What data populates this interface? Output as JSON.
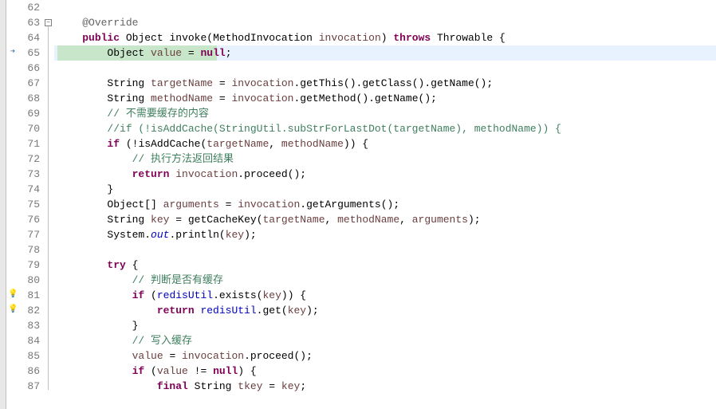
{
  "line_start": 62,
  "lines": [
    {
      "num": 62,
      "marker": null,
      "fold": null,
      "tokens": []
    },
    {
      "num": 63,
      "marker": null,
      "fold": "minus",
      "tokens": [
        {
          "t": "    ",
          "c": ""
        },
        {
          "t": "@Override",
          "c": "anno"
        }
      ]
    },
    {
      "num": 64,
      "marker": null,
      "fold": null,
      "tokens": [
        {
          "t": "    ",
          "c": ""
        },
        {
          "t": "public",
          "c": "kw"
        },
        {
          "t": " ",
          "c": ""
        },
        {
          "t": "Object",
          "c": "type"
        },
        {
          "t": " ",
          "c": ""
        },
        {
          "t": "invoke",
          "c": "method"
        },
        {
          "t": "(",
          "c": "punct"
        },
        {
          "t": "MethodInvocation",
          "c": "type"
        },
        {
          "t": " ",
          "c": ""
        },
        {
          "t": "invocation",
          "c": "param"
        },
        {
          "t": ") ",
          "c": "punct"
        },
        {
          "t": "throws",
          "c": "kw"
        },
        {
          "t": " ",
          "c": ""
        },
        {
          "t": "Throwable",
          "c": "type"
        },
        {
          "t": " {",
          "c": "punct"
        }
      ]
    },
    {
      "num": 65,
      "marker": "arrow",
      "fold": null,
      "highlight": "full",
      "partial_highlight_width": 200,
      "tokens": [
        {
          "t": "        ",
          "c": ""
        },
        {
          "t": "Object",
          "c": "type"
        },
        {
          "t": " ",
          "c": ""
        },
        {
          "t": "value",
          "c": "local"
        },
        {
          "t": " = ",
          "c": "punct"
        },
        {
          "t": "null",
          "c": "kw"
        },
        {
          "t": ";",
          "c": "punct"
        }
      ]
    },
    {
      "num": 66,
      "marker": null,
      "fold": null,
      "tokens": []
    },
    {
      "num": 67,
      "marker": null,
      "fold": null,
      "tokens": [
        {
          "t": "        ",
          "c": ""
        },
        {
          "t": "String",
          "c": "type"
        },
        {
          "t": " ",
          "c": ""
        },
        {
          "t": "targetName",
          "c": "local"
        },
        {
          "t": " = ",
          "c": "punct"
        },
        {
          "t": "invocation",
          "c": "param"
        },
        {
          "t": ".",
          "c": "punct"
        },
        {
          "t": "getThis",
          "c": "method"
        },
        {
          "t": "().",
          "c": "punct"
        },
        {
          "t": "getClass",
          "c": "method"
        },
        {
          "t": "().",
          "c": "punct"
        },
        {
          "t": "getName",
          "c": "method"
        },
        {
          "t": "();",
          "c": "punct"
        }
      ]
    },
    {
      "num": 68,
      "marker": null,
      "fold": null,
      "tokens": [
        {
          "t": "        ",
          "c": ""
        },
        {
          "t": "String",
          "c": "type"
        },
        {
          "t": " ",
          "c": ""
        },
        {
          "t": "methodName",
          "c": "local"
        },
        {
          "t": " = ",
          "c": "punct"
        },
        {
          "t": "invocation",
          "c": "param"
        },
        {
          "t": ".",
          "c": "punct"
        },
        {
          "t": "getMethod",
          "c": "method"
        },
        {
          "t": "().",
          "c": "punct"
        },
        {
          "t": "getName",
          "c": "method"
        },
        {
          "t": "();",
          "c": "punct"
        }
      ]
    },
    {
      "num": 69,
      "marker": null,
      "fold": null,
      "tokens": [
        {
          "t": "        ",
          "c": ""
        },
        {
          "t": "// 不需要缓存的内容",
          "c": "comment"
        }
      ]
    },
    {
      "num": 70,
      "marker": null,
      "fold": null,
      "tokens": [
        {
          "t": "        ",
          "c": ""
        },
        {
          "t": "//if (!isAddCache(StringUtil.subStrForLastDot(targetName), methodName)) {",
          "c": "comment"
        }
      ]
    },
    {
      "num": 71,
      "marker": null,
      "fold": null,
      "tokens": [
        {
          "t": "        ",
          "c": ""
        },
        {
          "t": "if",
          "c": "kw"
        },
        {
          "t": " (!",
          "c": "punct"
        },
        {
          "t": "isAddCache",
          "c": "method"
        },
        {
          "t": "(",
          "c": "punct"
        },
        {
          "t": "targetName",
          "c": "local"
        },
        {
          "t": ", ",
          "c": "punct"
        },
        {
          "t": "methodName",
          "c": "local"
        },
        {
          "t": ")) {",
          "c": "punct"
        }
      ]
    },
    {
      "num": 72,
      "marker": null,
      "fold": null,
      "tokens": [
        {
          "t": "            ",
          "c": ""
        },
        {
          "t": "// 执行方法返回结果",
          "c": "comment"
        }
      ]
    },
    {
      "num": 73,
      "marker": null,
      "fold": null,
      "tokens": [
        {
          "t": "            ",
          "c": ""
        },
        {
          "t": "return",
          "c": "kw"
        },
        {
          "t": " ",
          "c": ""
        },
        {
          "t": "invocation",
          "c": "param"
        },
        {
          "t": ".",
          "c": "punct"
        },
        {
          "t": "proceed",
          "c": "method"
        },
        {
          "t": "();",
          "c": "punct"
        }
      ]
    },
    {
      "num": 74,
      "marker": null,
      "fold": null,
      "tokens": [
        {
          "t": "        }",
          "c": "punct"
        }
      ]
    },
    {
      "num": 75,
      "marker": null,
      "fold": null,
      "tokens": [
        {
          "t": "        ",
          "c": ""
        },
        {
          "t": "Object",
          "c": "type"
        },
        {
          "t": "[] ",
          "c": "punct"
        },
        {
          "t": "arguments",
          "c": "local"
        },
        {
          "t": " = ",
          "c": "punct"
        },
        {
          "t": "invocation",
          "c": "param"
        },
        {
          "t": ".",
          "c": "punct"
        },
        {
          "t": "getArguments",
          "c": "method"
        },
        {
          "t": "();",
          "c": "punct"
        }
      ]
    },
    {
      "num": 76,
      "marker": null,
      "fold": null,
      "tokens": [
        {
          "t": "        ",
          "c": ""
        },
        {
          "t": "String",
          "c": "type"
        },
        {
          "t": " ",
          "c": ""
        },
        {
          "t": "key",
          "c": "local"
        },
        {
          "t": " = ",
          "c": "punct"
        },
        {
          "t": "getCacheKey",
          "c": "method"
        },
        {
          "t": "(",
          "c": "punct"
        },
        {
          "t": "targetName",
          "c": "local"
        },
        {
          "t": ", ",
          "c": "punct"
        },
        {
          "t": "methodName",
          "c": "local"
        },
        {
          "t": ", ",
          "c": "punct"
        },
        {
          "t": "arguments",
          "c": "local"
        },
        {
          "t": ");",
          "c": "punct"
        }
      ]
    },
    {
      "num": 77,
      "marker": null,
      "fold": null,
      "tokens": [
        {
          "t": "        ",
          "c": ""
        },
        {
          "t": "System",
          "c": "type"
        },
        {
          "t": ".",
          "c": "punct"
        },
        {
          "t": "out",
          "c": "static-field"
        },
        {
          "t": ".",
          "c": "punct"
        },
        {
          "t": "println",
          "c": "method"
        },
        {
          "t": "(",
          "c": "punct"
        },
        {
          "t": "key",
          "c": "local"
        },
        {
          "t": ");",
          "c": "punct"
        }
      ]
    },
    {
      "num": 78,
      "marker": null,
      "fold": null,
      "tokens": []
    },
    {
      "num": 79,
      "marker": null,
      "fold": null,
      "tokens": [
        {
          "t": "        ",
          "c": ""
        },
        {
          "t": "try",
          "c": "kw"
        },
        {
          "t": " {",
          "c": "punct"
        }
      ]
    },
    {
      "num": 80,
      "marker": null,
      "fold": null,
      "tokens": [
        {
          "t": "            ",
          "c": ""
        },
        {
          "t": "// 判断是否有缓存",
          "c": "comment"
        }
      ]
    },
    {
      "num": 81,
      "marker": "light",
      "fold": null,
      "tokens": [
        {
          "t": "            ",
          "c": ""
        },
        {
          "t": "if",
          "c": "kw"
        },
        {
          "t": " (",
          "c": "punct"
        },
        {
          "t": "redisUtil",
          "c": "field"
        },
        {
          "t": ".",
          "c": "punct"
        },
        {
          "t": "exists",
          "c": "method"
        },
        {
          "t": "(",
          "c": "punct"
        },
        {
          "t": "key",
          "c": "local"
        },
        {
          "t": ")) {",
          "c": "punct"
        }
      ]
    },
    {
      "num": 82,
      "marker": "light",
      "fold": null,
      "tokens": [
        {
          "t": "                ",
          "c": ""
        },
        {
          "t": "return",
          "c": "kw"
        },
        {
          "t": " ",
          "c": ""
        },
        {
          "t": "redisUtil",
          "c": "field"
        },
        {
          "t": ".",
          "c": "punct"
        },
        {
          "t": "get",
          "c": "method"
        },
        {
          "t": "(",
          "c": "punct"
        },
        {
          "t": "key",
          "c": "local"
        },
        {
          "t": ");",
          "c": "punct"
        }
      ]
    },
    {
      "num": 83,
      "marker": null,
      "fold": null,
      "tokens": [
        {
          "t": "            }",
          "c": "punct"
        }
      ]
    },
    {
      "num": 84,
      "marker": null,
      "fold": null,
      "tokens": [
        {
          "t": "            ",
          "c": ""
        },
        {
          "t": "// 写入缓存",
          "c": "comment"
        }
      ]
    },
    {
      "num": 85,
      "marker": null,
      "fold": null,
      "tokens": [
        {
          "t": "            ",
          "c": ""
        },
        {
          "t": "value",
          "c": "local"
        },
        {
          "t": " = ",
          "c": "punct"
        },
        {
          "t": "invocation",
          "c": "param"
        },
        {
          "t": ".",
          "c": "punct"
        },
        {
          "t": "proceed",
          "c": "method"
        },
        {
          "t": "();",
          "c": "punct"
        }
      ]
    },
    {
      "num": 86,
      "marker": null,
      "fold": null,
      "tokens": [
        {
          "t": "            ",
          "c": ""
        },
        {
          "t": "if",
          "c": "kw"
        },
        {
          "t": " (",
          "c": "punct"
        },
        {
          "t": "value",
          "c": "local"
        },
        {
          "t": " != ",
          "c": "punct"
        },
        {
          "t": "null",
          "c": "kw"
        },
        {
          "t": ") {",
          "c": "punct"
        }
      ]
    },
    {
      "num": 87,
      "marker": null,
      "fold": null,
      "tokens": [
        {
          "t": "                ",
          "c": ""
        },
        {
          "t": "final",
          "c": "kw"
        },
        {
          "t": " ",
          "c": ""
        },
        {
          "t": "String",
          "c": "type"
        },
        {
          "t": " ",
          "c": ""
        },
        {
          "t": "tkey",
          "c": "local"
        },
        {
          "t": " = ",
          "c": "punct"
        },
        {
          "t": "key",
          "c": "local"
        },
        {
          "t": ";",
          "c": "punct"
        }
      ]
    }
  ],
  "marker_glyphs": {
    "arrow": "➔",
    "light": "💡"
  },
  "fold_glyphs": {
    "minus": "−"
  }
}
